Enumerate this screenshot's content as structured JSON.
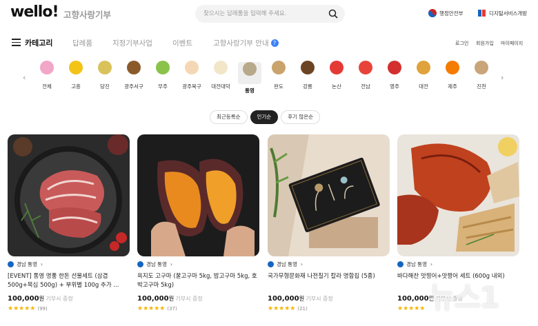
{
  "header": {
    "logo": "wello!",
    "brand_sub": "고향사랑기부",
    "search_placeholder": "찾으시는 답례품을 입력해 주세요.",
    "gov1": "행정안전부",
    "gov2": "디지털서비스개방"
  },
  "nav": {
    "category": "카테고리",
    "items": [
      "답례품",
      "지정기부사업",
      "이벤트",
      "고향사랑기부 안내"
    ],
    "help_mark": "?",
    "util": [
      "로그인",
      "회원가입",
      "마이페이지"
    ]
  },
  "categories": [
    {
      "label": "전체",
      "icon": "all-icon",
      "color": "#f2a6c8"
    },
    {
      "label": "고흥",
      "icon": "yuzu-icon",
      "color": "#f3c316"
    },
    {
      "label": "당진",
      "icon": "rice-icon",
      "color": "#d9c25a"
    },
    {
      "label": "광주서구",
      "icon": "bear-icon",
      "color": "#8b5a2b"
    },
    {
      "label": "무주",
      "icon": "grape-icon",
      "color": "#8bc34a"
    },
    {
      "label": "광주북구",
      "icon": "character-icon",
      "color": "#f5d7b5"
    },
    {
      "label": "대전대덕",
      "icon": "duck-icon",
      "color": "#f2e6c9"
    },
    {
      "label": "통영",
      "icon": "oyster-icon",
      "color": "#b8a98a",
      "active": true
    },
    {
      "label": "완도",
      "icon": "abalone-icon",
      "color": "#c9a36c"
    },
    {
      "label": "강릉",
      "icon": "coffee-icon",
      "color": "#6b4423"
    },
    {
      "label": "논산",
      "icon": "strawberry-icon",
      "color": "#e53935"
    },
    {
      "label": "전남",
      "icon": "flower-icon",
      "color": "#e8433a"
    },
    {
      "label": "영주",
      "icon": "apple-icon",
      "color": "#d32f2f"
    },
    {
      "label": "대전",
      "icon": "bread-icon",
      "color": "#e0a23a"
    },
    {
      "label": "제주",
      "icon": "tangerine-icon",
      "color": "#f57c00"
    },
    {
      "label": "진천",
      "icon": "rice-bag-icon",
      "color": "#c9a57a"
    }
  ],
  "sort_chips": [
    {
      "label": "최근등록순",
      "active": false
    },
    {
      "label": "인기순",
      "active": true
    },
    {
      "label": "후기 많은순",
      "active": false
    }
  ],
  "products": [
    {
      "region": "경남 통영",
      "title": "[EVENT] 통영 명품 한돈 선물세트 (삼겹500g+목심 500g) + 부위별 100g 추가 ...",
      "price": "100,000",
      "unit": "원",
      "price_note": "기부시 증정",
      "stars": "★★★★★",
      "reviews": "(99)"
    },
    {
      "region": "경남 통영",
      "title": "욕지도 고구마 (꿀고구마 5kg, 밤고구마 5kg, 호박고구마 5kg)",
      "price": "100,000",
      "unit": "원",
      "price_note": "기부시 증정",
      "stars": "★★★★★",
      "reviews": "(37)"
    },
    {
      "region": "경남 통영",
      "title": "국가무형문화재 나전칠기 칼라 명함집 (5종)",
      "price": "100,000",
      "unit": "원",
      "price_note": "기부시 증정",
      "stars": "★★★★★",
      "reviews": "(21)"
    },
    {
      "region": "경남 통영",
      "title": "바다해찬 맛찡어+맛짱어 세트 (600g 내외)",
      "price": "100,000",
      "unit": "원",
      "price_note": "기부시 증정",
      "stars": "★★★★★",
      "reviews": ""
    }
  ],
  "watermark": "뉴스1",
  "colors": {
    "accent": "#3b82f6",
    "star": "#f6b400",
    "chip_active": "#222222"
  }
}
